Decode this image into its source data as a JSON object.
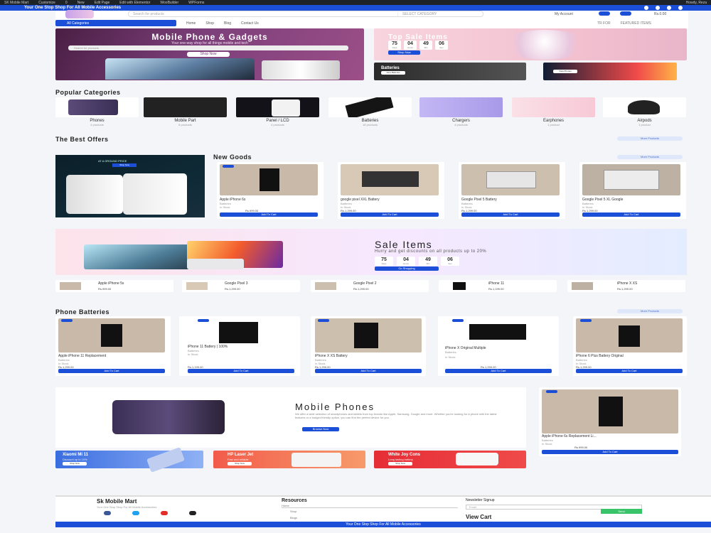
{
  "adminbar": {
    "items": [
      "SK Mobile Mart",
      "Customize",
      "0",
      "New",
      "Edit Page",
      "Edit with Elementor",
      "WooBuilder",
      "WPForms"
    ],
    "user": "Howdy, Reza"
  },
  "promo_bar": {
    "text": "Your One Stop Shop For All Mobile Accessories"
  },
  "header": {
    "search_placeholder": "Search for products",
    "category_select": "SELECT CATEGORY",
    "my_account": "My Account",
    "cart_total": "Rs.0.00",
    "all_categories": "All Categories",
    "nav": [
      "Home",
      "Shop",
      "Blog",
      "Contact Us"
    ],
    "nav_right": [
      "TR FOR",
      "FEATURED ITEMS"
    ]
  },
  "hero": {
    "title": "Mobile Phone & Gadgets",
    "subtitle": "Your one-way shop for all things mobile and tech",
    "search_placeholder": "Search for products",
    "button": "Shop Now"
  },
  "top_sale": {
    "title": "Top Sale Items",
    "counters": [
      {
        "value": "75",
        "label": "Days"
      },
      {
        "value": "04",
        "label": "Hours"
      },
      {
        "value": "49",
        "label": "Min"
      },
      {
        "value": "06",
        "label": "Sec"
      }
    ],
    "button": "Shop Now"
  },
  "promos": [
    {
      "label": "Batteries",
      "button": "View Batteries"
    },
    {
      "label": "",
      "button": "View Phones"
    }
  ],
  "popular_categories": {
    "title": "Popular Categories",
    "items": [
      {
        "name": "Phones",
        "count": "4 products"
      },
      {
        "name": "Mobile Part",
        "count": "8 products"
      },
      {
        "name": "Panel / LCD",
        "count": "4 products"
      },
      {
        "name": "Batteries",
        "count": "18 products"
      },
      {
        "name": "Chargers",
        "count": "4 products"
      },
      {
        "name": "Earphones",
        "count": "1 product"
      },
      {
        "name": "Airpods",
        "count": "1 product"
      }
    ]
  },
  "best_offers": {
    "title": "The Best Offers",
    "more": "More Products",
    "banner_label": "AT A GROUND PRICE",
    "banner_button": "Shop Now"
  },
  "new_goods": {
    "title": "New Goods",
    "more": "More Products",
    "items": [
      {
        "name": "Apple iPhone 6s",
        "meta": "Batteries",
        "stock": "In Stock",
        "price": "Rs.999.00",
        "button": "Add To Cart",
        "badge": true
      },
      {
        "name": "google pixel XXL Battery",
        "meta": "Batteries",
        "stock": "In Stock",
        "price": "Rs.1,299.00",
        "button": "Add To Cart",
        "badge": false
      },
      {
        "name": "Google Pixel 5 Battery",
        "meta": "Batteries",
        "stock": "In Stock",
        "price": "Rs.1,299.00",
        "button": "Add To Cart",
        "badge": false
      },
      {
        "name": "Google Pixel 5 XL Google",
        "meta": "Batteries",
        "stock": "In Stock",
        "price": "Rs.1,299.00",
        "button": "Add To Cart",
        "badge": false
      }
    ]
  },
  "sale": {
    "title": "Sale Items",
    "subtitle": "Hurry and get discounts on all products up to 20%",
    "counters": [
      {
        "value": "75",
        "label": "Days"
      },
      {
        "value": "04",
        "label": "Hours"
      },
      {
        "value": "49",
        "label": "Min"
      },
      {
        "value": "06",
        "label": "Sec"
      }
    ],
    "button": "Go Shopping"
  },
  "mini_products": [
    {
      "name": "Apple iPhone 5s",
      "price": "Rs.999.00"
    },
    {
      "name": "Google Pixel 3",
      "price": "Rs.1,299.00"
    },
    {
      "name": "Google Pixel 2",
      "price": "Rs.1,299.00"
    },
    {
      "name": "iPhone 11",
      "price": "Rs.1,199.00"
    },
    {
      "name": "iPhone X XS",
      "price": "Rs.1,299.00"
    }
  ],
  "phone_batteries": {
    "title": "Phone Batteries",
    "more": "More Products",
    "items": [
      {
        "name": "Apple iPhone 11 Replacement",
        "meta": "Batteries",
        "stock": "In Stock",
        "price": "Rs.1,299.00",
        "button": "Add To Cart"
      },
      {
        "name": "iPhone 11 Battery | 100%",
        "meta": "Batteries",
        "stock": "In Stock",
        "price": "Rs.1,199.00",
        "button": "Add To Cart"
      },
      {
        "name": "iPhone X XS Battery",
        "meta": "Batteries",
        "stock": "In Stock",
        "price": "Rs.1,299.00",
        "button": "Add To Cart"
      },
      {
        "name": "iPhone X Original Multiple",
        "meta": "Batteries",
        "stock": "In Stock",
        "price": "Rs.1,299.00",
        "button": "Add To Cart"
      },
      {
        "name": "iPhone 6 Plus Battery Original",
        "meta": "Batteries",
        "stock": "In Stock",
        "price": "Rs.1,299.00",
        "button": "Add To Cart"
      }
    ]
  },
  "mobile_phones": {
    "title": "Mobile Phones",
    "text": "We offer a wide selection of smartphones and tablets from top brands like Apple, Samsung, Google and more. Whether you're looking for a phone with the latest features or a budget-friendly option, you can find the perfect device for you.",
    "button": "Browse Now"
  },
  "featured_side": {
    "name": "Apple iPhone 6s Replacement Li...",
    "meta": "Batteries",
    "stock": "In Stock",
    "price": "Rs.999.00",
    "button": "Add To Cart"
  },
  "bottom_promos": [
    {
      "title": "Xiaomi Mi 11",
      "sub": "Discount up to 10%",
      "button": "Shop Now"
    },
    {
      "title": "HP Laser Jet",
      "sub": "Fast and reliable",
      "button": "Shop Now"
    },
    {
      "title": "White Joy Cons",
      "sub": "Long lasting battery",
      "button": "Shop Now"
    }
  ],
  "footer": {
    "brand": "Sk Mobile Mart",
    "tagline": "Your One Stop Shop For All Mobile Accessories",
    "resources_title": "Resources",
    "resources": [
      "Home",
      "Shop",
      "Blogs"
    ],
    "newsletter_title": "Newsletter Signup",
    "newsletter_placeholder": "Email",
    "newsletter_button": "Send",
    "view_cart": "View Cart",
    "bottom_text": "Your One Stop Shop For All Mobile Accessories"
  },
  "colors": {
    "accent": "#1c4fd8",
    "admin": "#1d2327"
  }
}
